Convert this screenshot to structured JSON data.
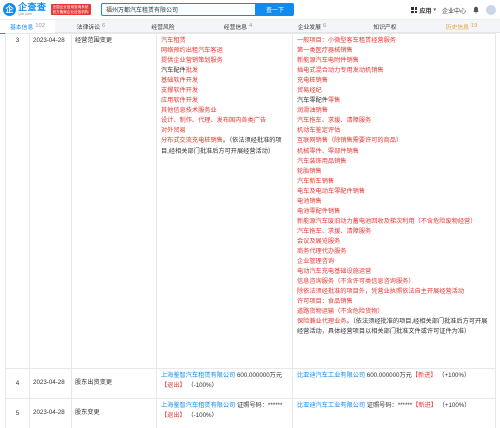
{
  "header": {
    "logo_mark": "企",
    "logo_cn": "企查查",
    "logo_en": "Qcc.com",
    "logo_badge": "全国企业信用查询系统 官方备案企业征信机构",
    "search_value": "福州万都汽车租赁有限公司",
    "search_button": "查一下",
    "app_label": "应用",
    "enterprise_center": "企业中心"
  },
  "tabs": [
    {
      "label": "基本信息",
      "count": "102",
      "active": true
    },
    {
      "label": "法律诉讼",
      "count": "6"
    },
    {
      "label": "经营风险",
      "count": ""
    },
    {
      "label": "经营信息",
      "count": "4"
    },
    {
      "label": "企业发展",
      "count": "6"
    },
    {
      "label": "知识产权",
      "count": ""
    },
    {
      "label": "历史信息",
      "count": "19",
      "history": true
    }
  ],
  "rows": [
    {
      "index": "3",
      "date": "2023-04-28",
      "item": "经营范围变更",
      "before": [
        {
          "text": "汽车租赁",
          "hl": true
        },
        {
          "text": "网络预约出租汽车客运",
          "hl": true
        },
        {
          "text": "提供企业营销策划服务",
          "hl": true
        },
        {
          "text": "汽车配件批发",
          "mixed": [
            {
              "t": "汽车配件",
              "hl": false
            },
            {
              "t": "批发",
              "hl": true
            }
          ]
        },
        {
          "text": "基础软件开发",
          "hl": true
        },
        {
          "text": "支撑软件开发",
          "hl": true
        },
        {
          "text": "应用软件开发",
          "hl": true
        },
        {
          "text": "其他信息技术服务业",
          "hl": true
        },
        {
          "text": "设计、制作、代理、发布国内各类广告",
          "hl": true
        },
        {
          "text": "对外贸易",
          "hl": true
        },
        {
          "text": "分布式交流充电桩销售",
          "mixed": [
            {
              "t": "分布式交流充电桩销售",
              "hl": true
            },
            {
              "t": "。（依法须经批准的项目,经相关部门批准后方可开展经营活动）",
              "hl": false
            }
          ]
        }
      ],
      "after": [
        {
          "text": "一般项目：小微型客车租赁经营服务",
          "hl": true
        },
        {
          "text": "第一类医疗器械销售",
          "hl": true
        },
        {
          "text": "新能源汽车电附件销售",
          "hl": true
        },
        {
          "text": "插电式混合动力专用发动机销售",
          "hl": true
        },
        {
          "text": "充电桩销售",
          "hl": true
        },
        {
          "text": "贸易经纪",
          "hl": true
        },
        {
          "text": "汽车零配件零售",
          "mixed": [
            {
              "t": "汽车零配件",
              "hl": false
            },
            {
              "t": "零售",
              "hl": true
            }
          ]
        },
        {
          "text": "润滑油销售",
          "hl": true
        },
        {
          "text": "汽车拖车、求援、清障服务",
          "hl": true
        },
        {
          "text": "机动车鉴定评估",
          "hl": true
        },
        {
          "text": "互联网销售（除销售需要许可的商品）",
          "hl": true
        },
        {
          "text": "机械零件、零部件销售",
          "hl": true
        },
        {
          "text": "汽车装饰用品销售",
          "hl": true
        },
        {
          "text": "轮胎销售",
          "hl": true
        },
        {
          "text": "汽车新车销售",
          "hl": true
        },
        {
          "text": "电车及电动车零配件销售",
          "hl": true
        },
        {
          "text": "电池销售",
          "hl": true
        },
        {
          "text": "电池零配件销售",
          "hl": true
        },
        {
          "text": "新能源汽车废旧动力蓄电池回收及梯次利用（不含危险废物经营）",
          "hl": true
        },
        {
          "text": "汽车拖车、求援、清障服务",
          "hl": true
        },
        {
          "text": "会议及展览服务",
          "hl": true
        },
        {
          "text": "商务代理代办服务",
          "hl": true
        },
        {
          "text": "企业管理咨询",
          "hl": true
        },
        {
          "text": "电动汽车充电基础设施运营",
          "hl": true
        },
        {
          "text": "信息咨询服务（不含许可类信息咨询服务）",
          "hl": true
        },
        {
          "text": "除依法须经批准的项目外，凭营业执照依法自主开展经营活动",
          "hl": true
        },
        {
          "text": "许可项目：食品销售",
          "hl": true
        },
        {
          "text": "道路货物运输（不含危险货物）",
          "hl": true
        },
        {
          "text": "保险兼业代理业务",
          "mixed": [
            {
              "t": "保险兼业代理业务",
              "hl": true
            },
            {
              "t": "。（依法须经批准的项目,经相关部门批准后方可开展经营活动，具体经营项目以相关部门批准文件或许可证件为准）",
              "hl": false
            }
          ]
        }
      ]
    },
    {
      "index": "4",
      "date": "2023-04-28",
      "item": "股东出资变更",
      "before_company": "上海鉴智汽车租赁有限公司",
      "before_amount": "600.000000万元",
      "before_tag": "【退出】",
      "before_pct": "（-100%）",
      "after_company": "比亚迪汽车工业有限公司",
      "after_amount": "600.000000万元",
      "after_tag": "【新进】",
      "after_pct": "（+100%）"
    },
    {
      "index": "5",
      "date": "2023-04-28",
      "item": "股东变更",
      "before_company": "上海鉴智汽车租赁有限公司",
      "before_cert": "证照号码：******",
      "before_tag": "【退出】",
      "before_pct": "（-100%）",
      "after_company": "比亚迪汽车工业有限公司",
      "after_cert": "证照号码：******",
      "after_tag": "【新进】",
      "after_pct": "（+100%）"
    }
  ],
  "colors": {
    "accent": "#128bed",
    "highlight": "#e53935",
    "history": "#e6a23c"
  }
}
